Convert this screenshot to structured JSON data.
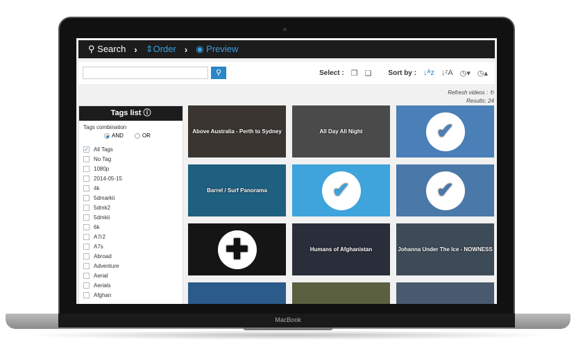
{
  "device": {
    "brand": "MacBook"
  },
  "nav": {
    "search": "Search",
    "order": "Order",
    "preview": "Preview"
  },
  "toolbar": {
    "search_value": "",
    "select_label": "Select :",
    "sort_label": "Sort by :"
  },
  "status": {
    "refresh": "Refresh videos :",
    "results": "Results: 24"
  },
  "sidebar": {
    "title": "Tags list",
    "combination_label": "Tags combination",
    "and": "AND",
    "or": "OR",
    "tags": [
      {
        "label": "All Tags",
        "checked": true
      },
      {
        "label": "No Tag"
      },
      {
        "label": "1080p"
      },
      {
        "label": "2014-05-15"
      },
      {
        "label": "4k"
      },
      {
        "label": "5dmarkii"
      },
      {
        "label": "5dmk2"
      },
      {
        "label": "5dmkii"
      },
      {
        "label": "6k"
      },
      {
        "label": "A7r2"
      },
      {
        "label": "A7s"
      },
      {
        "label": "Abroad"
      },
      {
        "label": "Adventure"
      },
      {
        "label": "Aerial"
      },
      {
        "label": "Aerials"
      },
      {
        "label": "Afghan"
      }
    ]
  },
  "videos": [
    {
      "title": "Above Australia - Perth to Sydney",
      "bg": "#3a3530",
      "state": ""
    },
    {
      "title": "All Day All Night",
      "bg": "#4a4a4a",
      "state": ""
    },
    {
      "title": "",
      "bg": "#4a7fb8",
      "state": "selected"
    },
    {
      "title": "Barrel / Surf Panorama",
      "bg": "#1f5f80",
      "state": ""
    },
    {
      "title": "",
      "bg": "#3fa3dc",
      "state": "selected"
    },
    {
      "title": "",
      "bg": "#4a78a8",
      "state": "selected"
    },
    {
      "title": "",
      "bg": "#151515",
      "state": "add"
    },
    {
      "title": "Humans of Afghanistan",
      "bg": "#2a2d3a",
      "state": ""
    },
    {
      "title": "Johanna Under The Ice - NOWNESS",
      "bg": "#3d4a58",
      "state": ""
    },
    {
      "title": "",
      "bg": "#2a5b8a",
      "state": ""
    },
    {
      "title": "",
      "bg": "#5a6040",
      "state": ""
    },
    {
      "title": "",
      "bg": "#4a5a6e",
      "state": ""
    }
  ],
  "colors": {
    "accent": "#2a86c8",
    "nav_bg": "#1c1c1c"
  }
}
